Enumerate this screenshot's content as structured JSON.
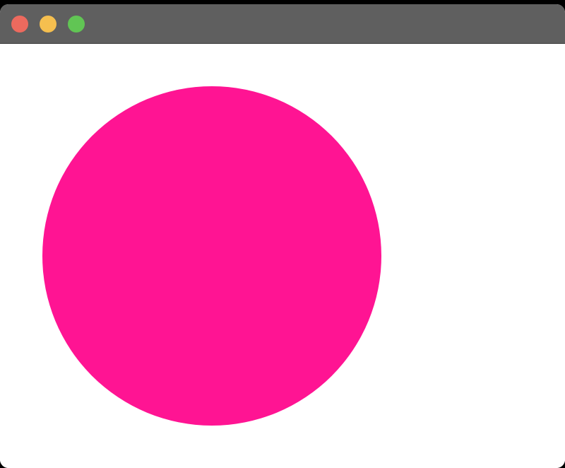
{
  "window": {
    "controls": [
      {
        "role": "close",
        "icon": "close-dot-icon",
        "color": "#ed6a5e"
      },
      {
        "role": "minimize",
        "icon": "minimize-dot-icon",
        "color": "#f5bf4f"
      },
      {
        "role": "zoom",
        "icon": "zoom-dot-icon",
        "color": "#61c554"
      }
    ],
    "titlebar_color": "#5f5f5f"
  },
  "canvas": {
    "background": "#ffffff",
    "shape": {
      "type": "circle",
      "fill": "#ff1493"
    }
  }
}
